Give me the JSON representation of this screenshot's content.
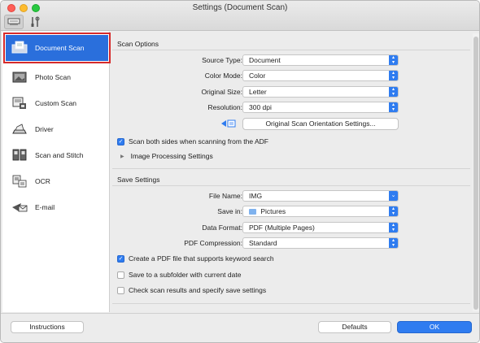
{
  "window": {
    "title": "Settings (Document Scan)"
  },
  "sidebar": {
    "items": [
      {
        "label": "Document Scan",
        "icon": "document-scan-icon",
        "selected": true
      },
      {
        "label": "Photo Scan",
        "icon": "photo-scan-icon"
      },
      {
        "label": "Custom Scan",
        "icon": "custom-scan-icon"
      },
      {
        "label": "Driver",
        "icon": "driver-icon"
      },
      {
        "label": "Scan and Stitch",
        "icon": "scan-stitch-icon"
      },
      {
        "label": "OCR",
        "icon": "ocr-icon"
      },
      {
        "label": "E-mail",
        "icon": "email-icon"
      }
    ]
  },
  "scan_options": {
    "title": "Scan Options",
    "source_type": {
      "label": "Source Type:",
      "value": "Document"
    },
    "color_mode": {
      "label": "Color Mode:",
      "value": "Color"
    },
    "original_size": {
      "label": "Original Size:",
      "value": "Letter"
    },
    "resolution": {
      "label": "Resolution:",
      "value": "300 dpi"
    },
    "orientation_button": "Original Scan Orientation Settings...",
    "scan_both_sides": {
      "label": "Scan both sides when scanning from the ADF",
      "checked": true
    },
    "image_processing": "Image Processing Settings"
  },
  "save_settings": {
    "title": "Save Settings",
    "file_name": {
      "label": "File Name:",
      "value": "IMG"
    },
    "save_in": {
      "label": "Save in:",
      "value": "Pictures"
    },
    "data_format": {
      "label": "Data Format:",
      "value": "PDF (Multiple Pages)"
    },
    "pdf_compression": {
      "label": "PDF Compression:",
      "value": "Standard"
    },
    "keyword_search": {
      "label": "Create a PDF file that supports keyword search",
      "checked": true
    },
    "subfolder": {
      "label": "Save to a subfolder with current date",
      "checked": false
    },
    "check_results": {
      "label": "Check scan results and specify save settings",
      "checked": false
    }
  },
  "footer": {
    "instructions": "Instructions",
    "defaults": "Defaults",
    "ok": "OK"
  },
  "colors": {
    "accent": "#2f7cf0",
    "selected": "#2a6fdc",
    "highlight_border": "#d62a2a"
  }
}
